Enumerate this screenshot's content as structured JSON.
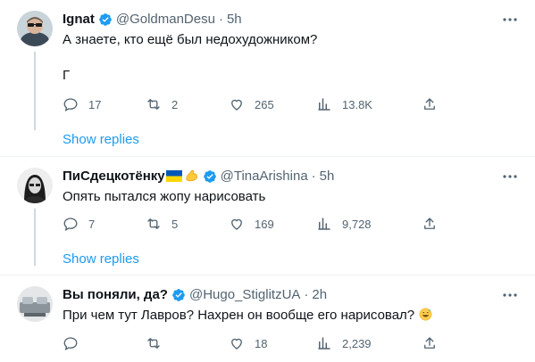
{
  "tweets": [
    {
      "name": "Ignat",
      "handle": "@GoldmanDesu",
      "time": "5h",
      "text_lines": [
        "А знаете, кто ещё был недохудожником?",
        "Г"
      ],
      "replies": "17",
      "retweets": "2",
      "likes": "265",
      "views": "13.8K",
      "show_replies": "Show replies"
    },
    {
      "name": "ПиСдецкотёнку",
      "name_emojis": [
        "ukraine-flag",
        "flexed-biceps"
      ],
      "handle": "@TinaArishina",
      "time": "5h",
      "text_lines": [
        "Опять пытался жопу нарисовать"
      ],
      "replies": "7",
      "retweets": "5",
      "likes": "169",
      "views": "9,728",
      "show_replies": "Show replies"
    },
    {
      "name": "Вы поняли, да?",
      "handle": "@Hugo_StiglitzUA",
      "time": "2h",
      "text_lines": [
        "При чем тут Лавров? Нахрен он вообще его нарисовал?"
      ],
      "text_emoji": "grinning-sweat",
      "replies": "",
      "retweets": "",
      "likes": "18",
      "views": "2,239"
    }
  ],
  "colors": {
    "accent": "#1d9bf0",
    "text": "#0f1419",
    "secondary": "#536471",
    "border": "#eff3f4",
    "thread": "#cfd9de"
  }
}
